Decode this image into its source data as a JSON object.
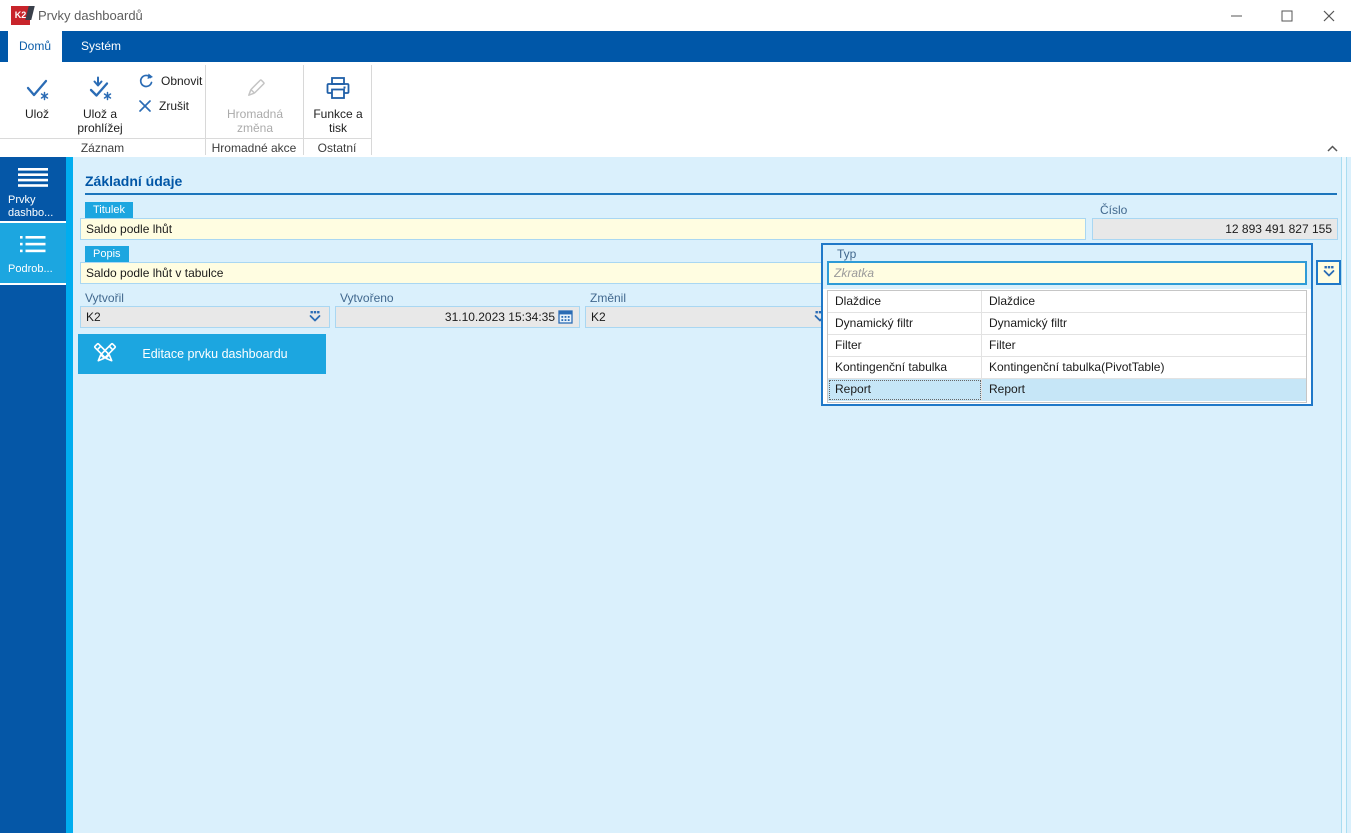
{
  "window": {
    "title": "Prvky dashboardů",
    "logo_text": "K2"
  },
  "ribbon": {
    "tabs": [
      {
        "label": "Domů",
        "active": true
      },
      {
        "label": "Systém",
        "active": false
      }
    ],
    "groups": [
      {
        "label": "Záznam",
        "buttons": [
          {
            "label": "Ulož",
            "enabled": true
          },
          {
            "label": "Ulož a prohlížej",
            "enabled": true
          },
          {
            "label": "Obnovit",
            "enabled": true
          },
          {
            "label": "Zrušit",
            "enabled": true
          }
        ]
      },
      {
        "label": "Hromadné akce",
        "buttons": [
          {
            "label": "Hromadná změna",
            "enabled": false
          }
        ]
      },
      {
        "label": "Ostatní",
        "buttons": [
          {
            "label": "Funkce a tisk",
            "enabled": true
          }
        ]
      }
    ]
  },
  "sidebar": {
    "items": [
      {
        "label": "Prvky dashbo...",
        "icon": "menu-icon",
        "active": true
      },
      {
        "label": "Podrob...",
        "icon": "detail-list-icon",
        "active": false
      }
    ]
  },
  "form": {
    "section_title": "Základní údaje",
    "fields": {
      "titulek": {
        "label": "Titulek",
        "value": "Saldo podle lhůt"
      },
      "cislo": {
        "label": "Číslo",
        "value": "12 893 491 827 155"
      },
      "popis": {
        "label": "Popis",
        "value": "Saldo podle lhůt v tabulce"
      },
      "vytvoril": {
        "label": "Vytvořil",
        "value": "K2"
      },
      "vytvoreno": {
        "label": "Vytvořeno",
        "value": "31.10.2023 15:34:35"
      },
      "zmenil": {
        "label": "Změnil",
        "value": "K2"
      }
    },
    "action_button": {
      "label": "Editace prvku dashboardu"
    }
  },
  "typ_dropdown": {
    "label": "Typ",
    "search_placeholder": "Zkratka",
    "options": [
      {
        "abbr": "Dlaždice",
        "name": "Dlaždice",
        "selected": false
      },
      {
        "abbr": "Dynamický filtr",
        "name": "Dynamický filtr",
        "selected": false
      },
      {
        "abbr": "Filter",
        "name": "Filter",
        "selected": false
      },
      {
        "abbr": "Kontingenční tabulka",
        "name": "Kontingenční tabulka(PivotTable)",
        "selected": false
      },
      {
        "abbr": "Report",
        "name": "Report",
        "selected": true
      }
    ]
  },
  "colors": {
    "dark_blue": "#0057A8",
    "cyan_accent": "#1CA6E0",
    "strip_cyan": "#00ADEF",
    "content_bg": "#DAF0FC",
    "field_yellow": "#FFFDE1",
    "field_gray": "#E8E8E8",
    "field_border": "#A9D7F2",
    "panel_border": "#1F78C8",
    "selected_row": "#C6E6F7",
    "ribbon_icon_blue": "#2B6CB5"
  }
}
